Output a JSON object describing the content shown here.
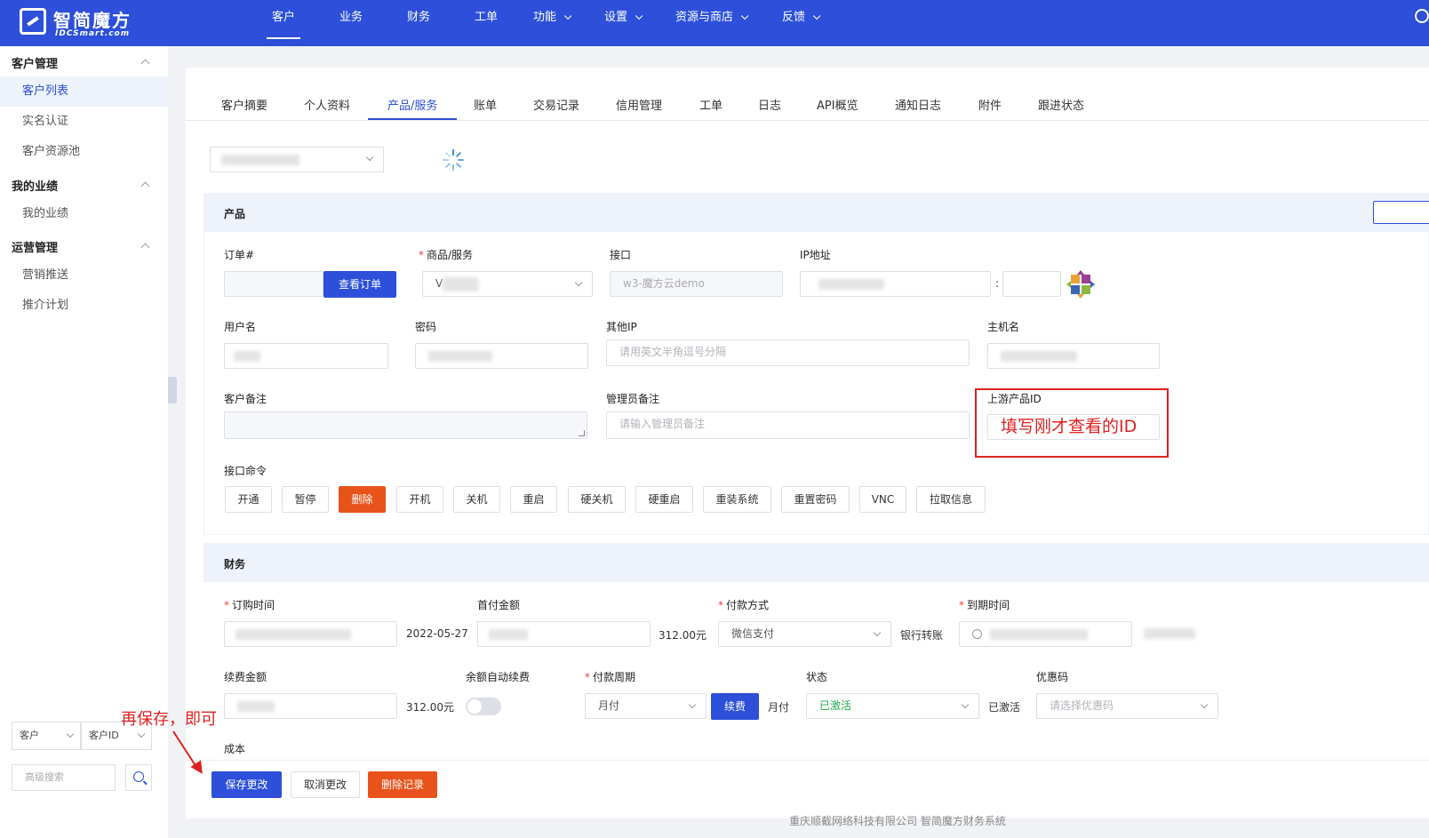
{
  "brand": {
    "title": "智简魔方",
    "subtitle": "IDCSmart.com"
  },
  "nav": [
    {
      "label": "客户",
      "active": true,
      "caret": false
    },
    {
      "label": "业务",
      "caret": false
    },
    {
      "label": "财务",
      "caret": false
    },
    {
      "label": "工单",
      "caret": false
    },
    {
      "label": "功能",
      "caret": true
    },
    {
      "label": "设置",
      "caret": true
    },
    {
      "label": "资源与商店",
      "caret": true
    },
    {
      "label": "反馈",
      "caret": true
    }
  ],
  "sidebar": {
    "groups": [
      {
        "title": "客户管理",
        "items": [
          "客户列表",
          "实名认证",
          "客户资源池"
        ]
      },
      {
        "title": "我的业绩",
        "items": [
          "我的业绩"
        ]
      },
      {
        "title": "运营管理",
        "items": [
          "营销推送",
          "推介计划"
        ]
      }
    ],
    "search_type": "客户",
    "search_field": "客户ID",
    "advanced_search": "高级搜索"
  },
  "tabs": [
    "客户摘要",
    "个人资料",
    "产品/服务",
    "账单",
    "交易记录",
    "信用管理",
    "工单",
    "日志",
    "API概览",
    "通知日志",
    "附件",
    "跟进状态"
  ],
  "product_section": {
    "title": "产品",
    "order_label": "订单#",
    "view_order_btn": "查看订单",
    "product_label": "商品/服务",
    "product_value": "V",
    "interface_label": "接口",
    "interface_value": "w3-魔方云demo",
    "ip_label": "IP地址",
    "ip_sep": ":",
    "username_label": "用户名",
    "password_label": "密码",
    "other_ip_label": "其他IP",
    "other_ip_placeholder": "请用英文半角逗号分隔",
    "hostname_label": "主机名",
    "customer_note_label": "客户备注",
    "admin_note_label": "管理员备注",
    "admin_note_placeholder": "请输入管理员备注",
    "upstream_id_label": "上游产品ID",
    "commands_label": "接口命令",
    "commands": [
      "开通",
      "暂停",
      "删除",
      "开机",
      "关机",
      "重启",
      "硬关机",
      "硬重启",
      "重装系统",
      "重置密码",
      "VNC",
      "拉取信息"
    ]
  },
  "finance_section": {
    "title": "财务",
    "order_time_label": "订购时间",
    "order_time_after": "2022-05-27",
    "first_amount_label": "首付金额",
    "first_amount_after": "312.00元",
    "payment_label": "付款方式",
    "payment_value": "微信支付",
    "payment_after": "银行转账",
    "due_label": "到期时间",
    "renew_amount_label": "续费金额",
    "renew_amount_after": "312.00元",
    "auto_renew_label": "余额自动续费",
    "cycle_label": "付款周期",
    "cycle_value": "月付",
    "renew_btn": "续费",
    "cycle_after": "月付",
    "status_label": "状态",
    "status_value": "已激活",
    "status_after": "已激活",
    "coupon_label": "优惠码",
    "coupon_placeholder": "请选择优惠码",
    "cost_label": "成本"
  },
  "actions": {
    "save": "保存更改",
    "cancel": "取消更改",
    "delete": "删除记录"
  },
  "annotations": {
    "fill_id": "填写刚才查看的ID",
    "save_hint": "再保存，即可"
  },
  "footer": "重庆顺截网络科技有限公司 智简魔方财务系统",
  "colors": {
    "primary": "#2d4fd9",
    "danger": "#e8531b",
    "annotation": "#e02020",
    "active_green": "#1fa84f"
  }
}
